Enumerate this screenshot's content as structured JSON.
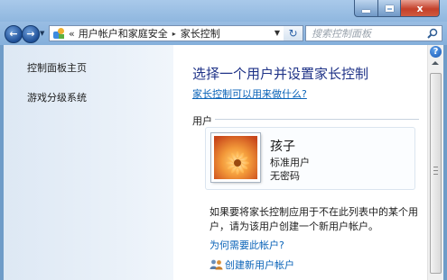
{
  "window": {
    "minimize_icon": "minimize-icon",
    "maximize_icon": "maximize-icon",
    "close_label": "x"
  },
  "nav": {
    "back_icon": "back-arrow-icon",
    "forward_icon": "forward-arrow-icon",
    "breadcrumb": {
      "prefix": "«",
      "items": [
        "用户帐户和家庭安全",
        "家长控制"
      ],
      "separator": "▸"
    },
    "refresh_icon": "refresh-icon",
    "search": {
      "placeholder": "搜索控制面板"
    }
  },
  "sidebar": {
    "items": [
      {
        "label": "控制面板主页"
      },
      {
        "label": "游戏分级系统"
      }
    ]
  },
  "main": {
    "heading": "选择一个用户并设置家长控制",
    "help_link": "家长控制可以用来做什么?",
    "group_label": "用户",
    "user": {
      "name": "孩子",
      "type": "标准用户",
      "password": "无密码"
    },
    "note": "如果要将家长控制应用于不在此列表中的某个用户，请为该用户创建一个新用户帐户。",
    "why_link": "为何需要此帐户?",
    "create_link": "创建新用户帐户"
  },
  "colors": {
    "link": "#0a63b8",
    "heading": "#1e3287",
    "sidebar_bg": "#e4edf7",
    "titlebar": "#99bde3"
  }
}
